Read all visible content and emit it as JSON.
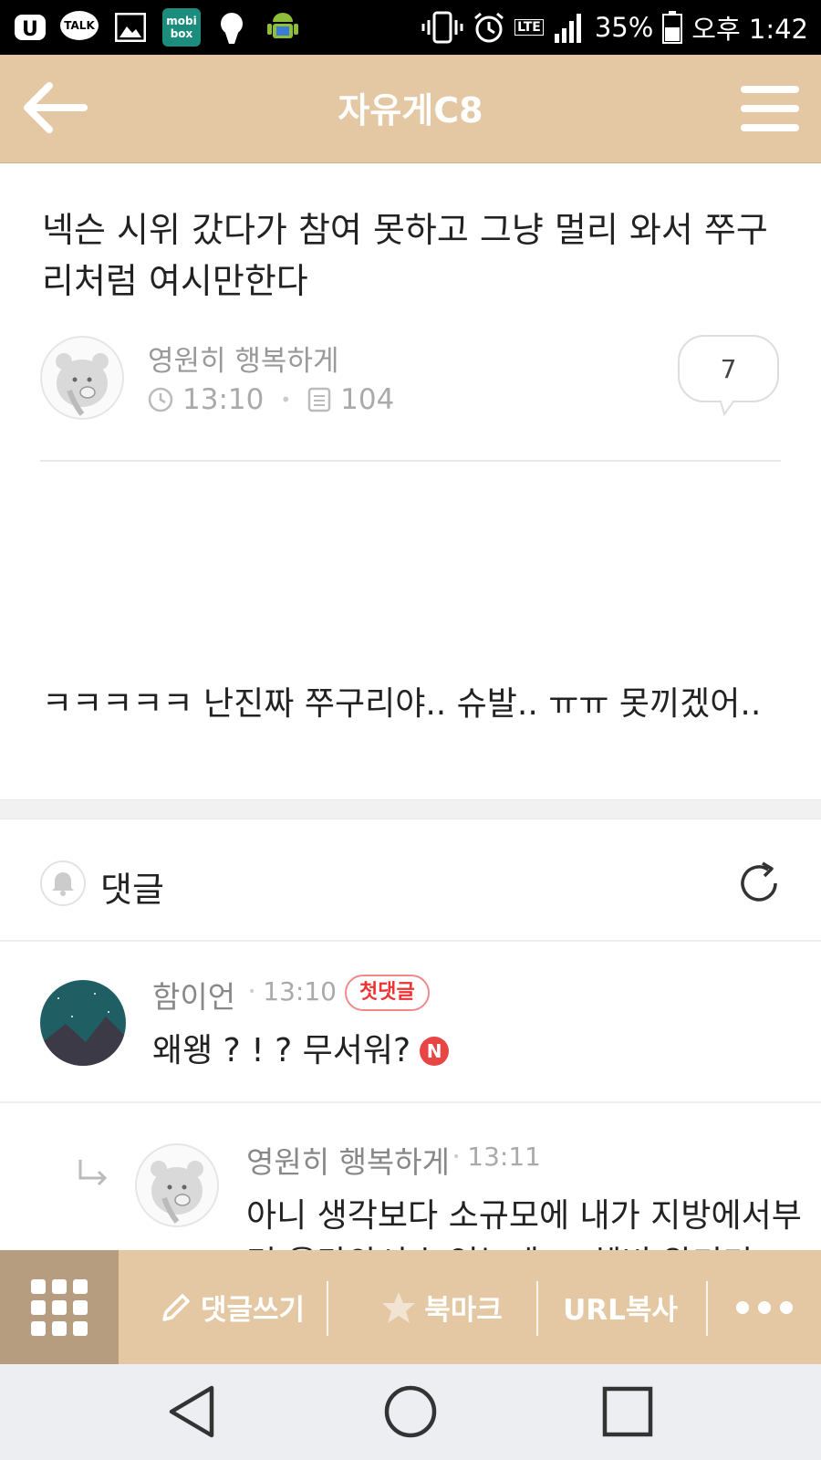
{
  "status_bar": {
    "app_icons": [
      "u-plus-icon",
      "kakaotalk-icon",
      "gallery-icon",
      "mobibox-icon",
      "avatar-head-icon",
      "android-icon"
    ],
    "talk_label": "TALK",
    "mobi_line1": "mobi",
    "mobi_line2": "box",
    "network": "LTE",
    "battery": "35%",
    "time": "오후 1:42"
  },
  "header": {
    "title": "자유게C8",
    "back_icon": "back-arrow-icon",
    "menu_icon": "hamburger-menu-icon"
  },
  "post": {
    "title": "넥슨 시위 갔다가 참여 못하고 그냥 멀리 와서 쭈구리처럼 여시만한다",
    "author": "영원히 행복하게",
    "time": "13:10",
    "views": "104",
    "comment_count": "7",
    "body": "ㅋㅋㅋㅋㅋ 난진짜 쭈구리야.. 슈발.. ㅠㅠ 못끼겠어.."
  },
  "comments": {
    "label": "댓글",
    "items": [
      {
        "author": "함이언",
        "time": "13:10",
        "badge": "첫댓글",
        "text": "왜왱 ? ! ? 무서워?",
        "new_badge": "N"
      },
      {
        "author": "영원히 행복하게",
        "time": "13:11",
        "text_line1": "아니 생각보다 소규모에 내가 지방에서부",
        "text_line2": "터 올라와서 늦었는데 ... 헤비 왕기기"
      }
    ]
  },
  "toolbar": {
    "write_comment": "댓글쓰기",
    "bookmark": "북마크",
    "copy_url": "URL복사"
  },
  "colors": {
    "header_bg": "#e4c7a3",
    "toolbar_grid_bg": "#b69d80",
    "badge_red": "#e84545"
  }
}
